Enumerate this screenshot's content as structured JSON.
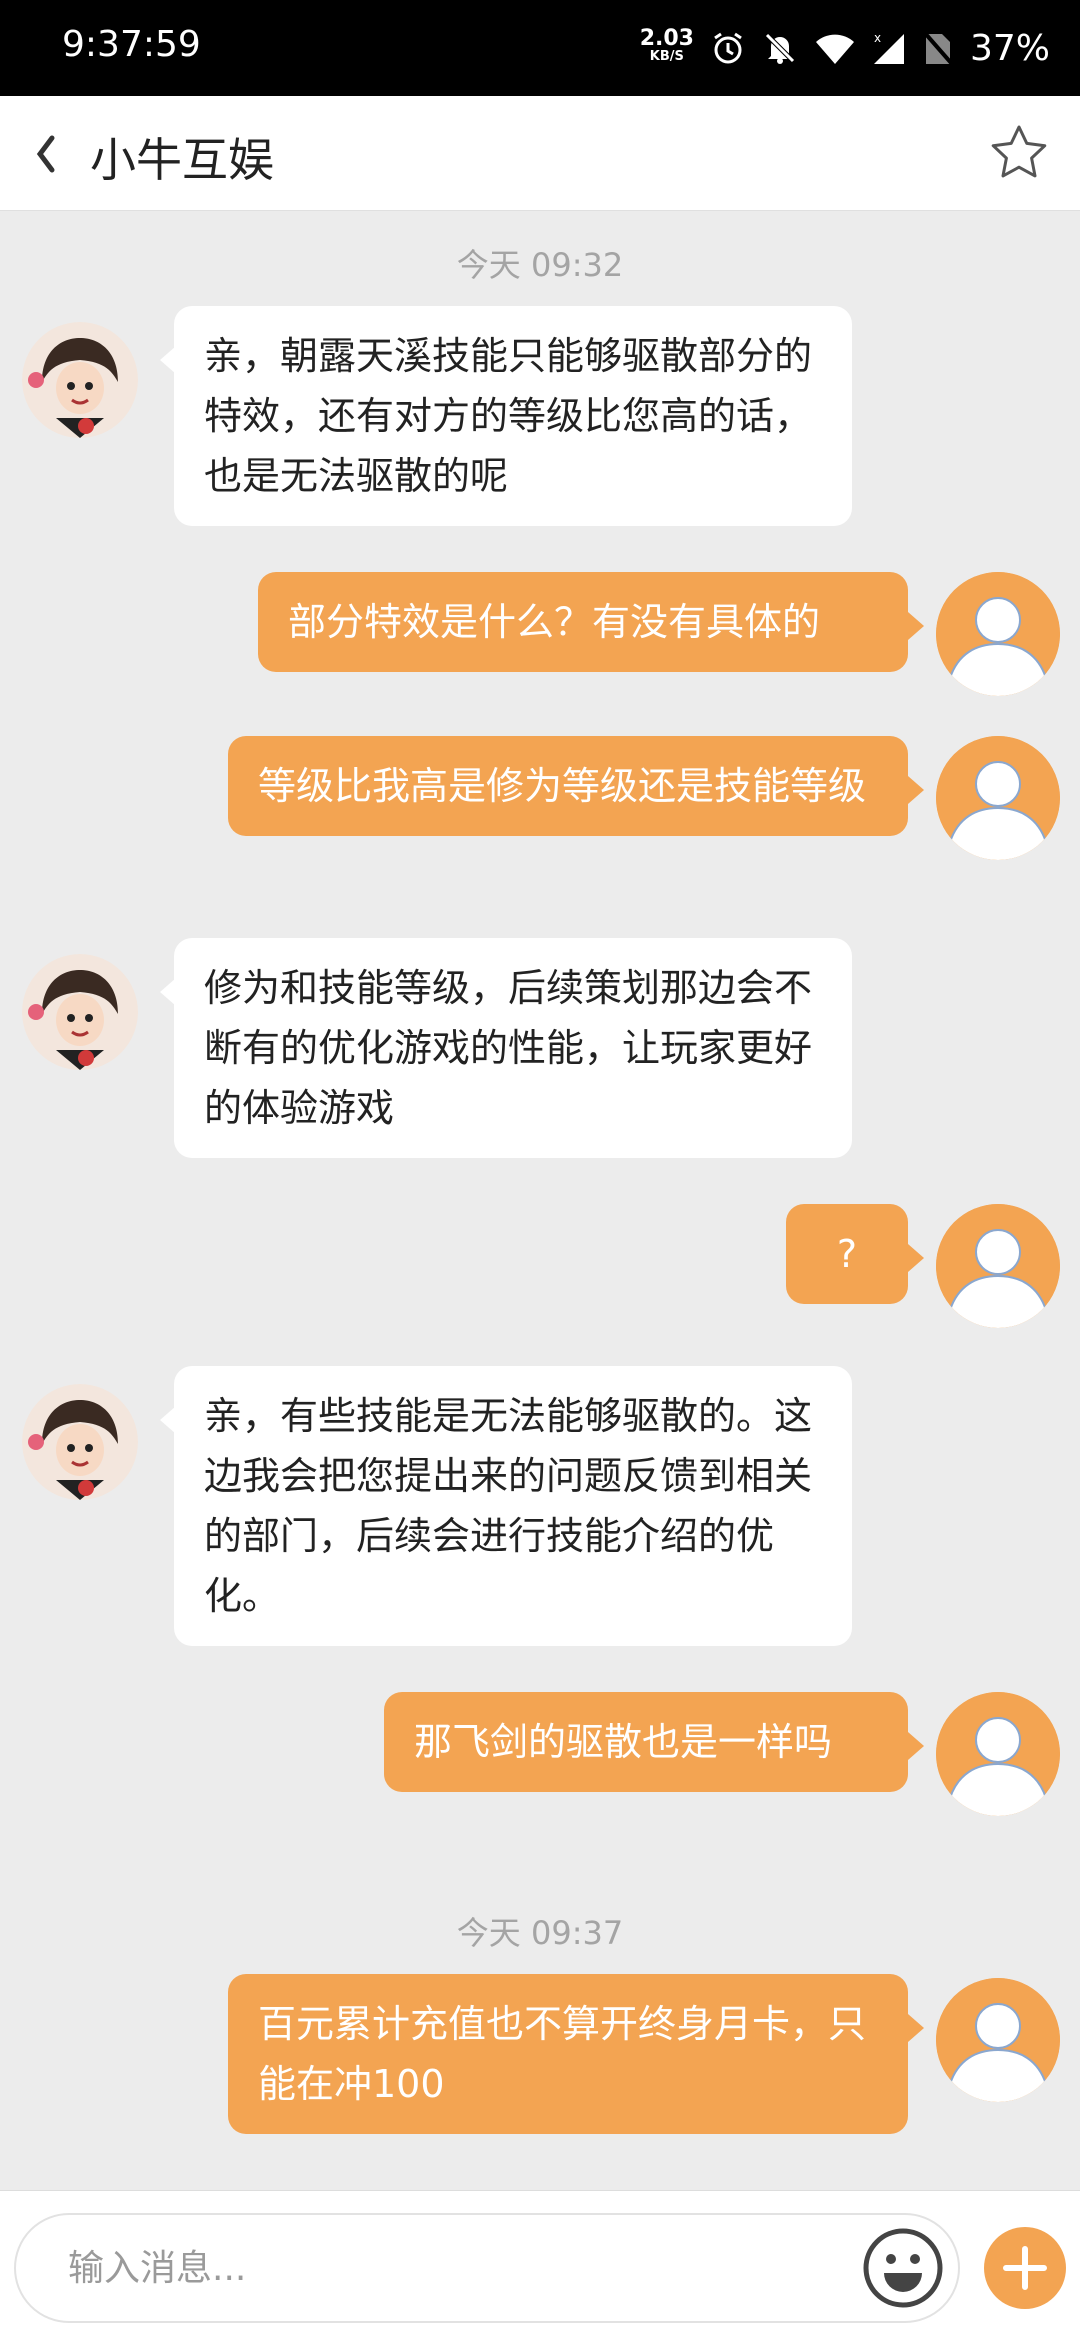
{
  "status_bar": {
    "time": "9:37:59",
    "net_speed_value": "2.03",
    "net_speed_unit": "KB/S",
    "battery": "37%"
  },
  "header": {
    "title": "小牛互娱",
    "back_icon": "chevron-left-icon",
    "favorite_icon": "star-outline-icon"
  },
  "timestamps": [
    "今天 09:32",
    "今天 09:37"
  ],
  "messages": [
    {
      "from": "agent",
      "text": "亲，朝露天溪技能只能够驱散部分的特效，还有对方的等级比您高的话，也是无法驱散的呢"
    },
    {
      "from": "user",
      "text": "部分特效是什么？有没有具体的"
    },
    {
      "from": "user",
      "text": "等级比我高是修为等级还是技能等级"
    },
    {
      "from": "agent",
      "text": "修为和技能等级，后续策划那边会不断有的优化游戏的性能，让玩家更好的体验游戏"
    },
    {
      "from": "user",
      "text": "?"
    },
    {
      "from": "agent",
      "text": "亲，有些技能是无法能够驱散的。这边我会把您提出来的问题反馈到相关的部门，后续会进行技能介绍的优化。"
    },
    {
      "from": "user",
      "text": "那飞剑的驱散也是一样吗"
    },
    {
      "from": "user",
      "text": "百元累计充值也不算开终身月卡，只能在冲100"
    }
  ],
  "input": {
    "placeholder": "输入消息..."
  },
  "colors": {
    "accent": "#f3a452",
    "background": "#ececec",
    "incoming_bubble": "#ffffff"
  }
}
